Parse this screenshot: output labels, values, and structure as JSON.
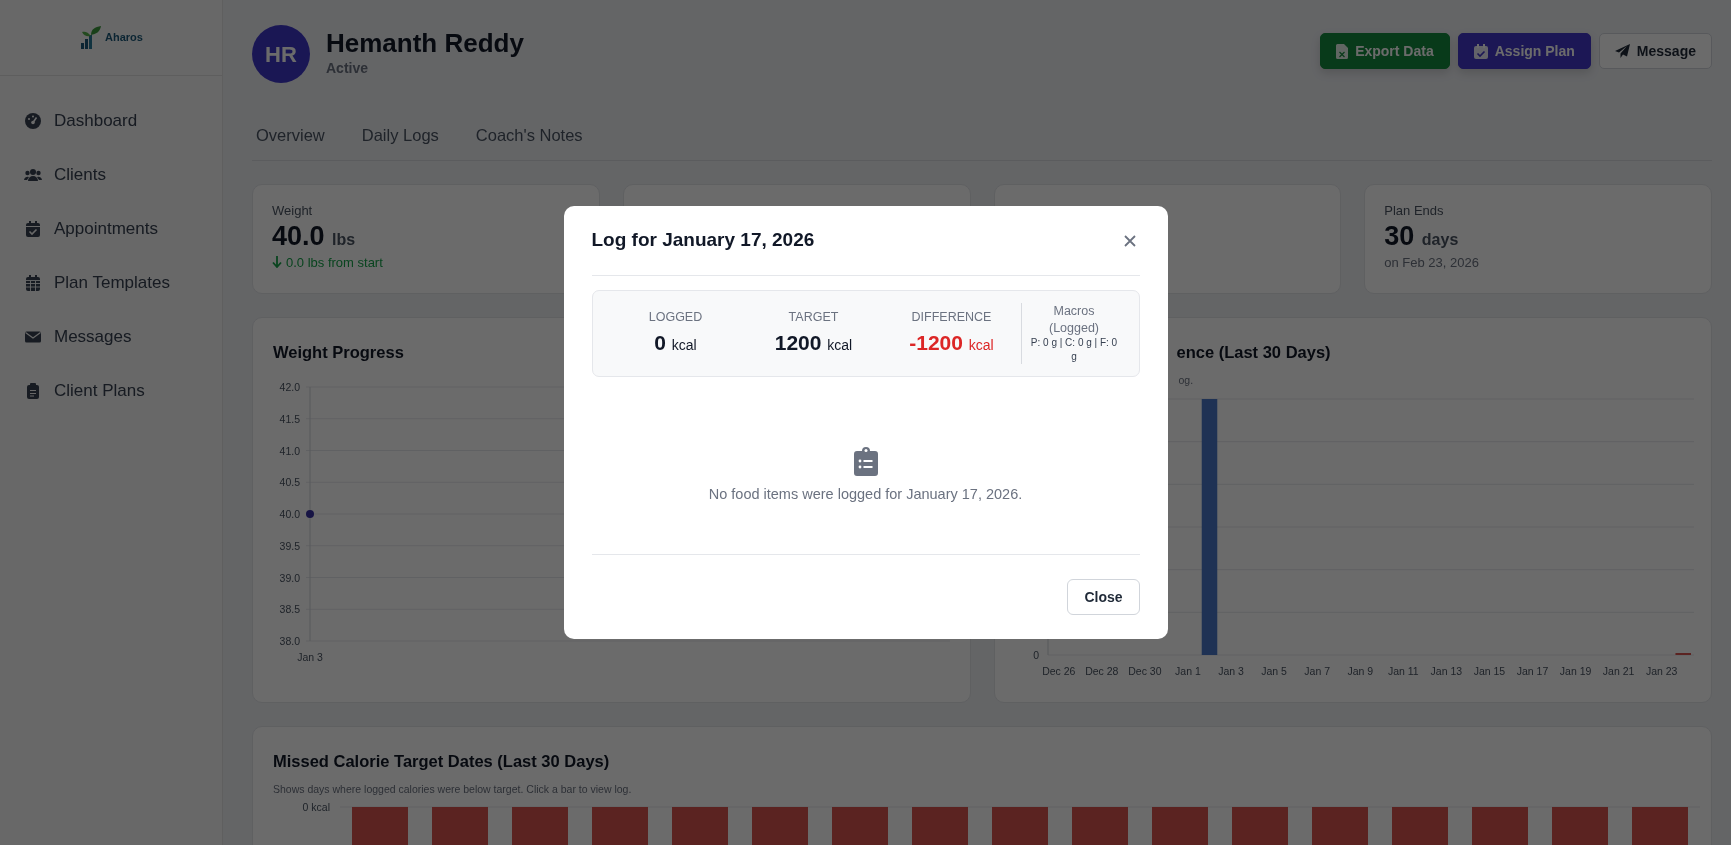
{
  "sidebar": {
    "logo": {
      "text": "Aharos"
    },
    "items": [
      {
        "label": "Dashboard",
        "selected": false
      },
      {
        "label": "Clients",
        "selected": false
      },
      {
        "label": "Appointments",
        "selected": false
      },
      {
        "label": "Plan Templates",
        "selected": false
      },
      {
        "label": "Messages",
        "selected": false
      },
      {
        "label": "Client Plans",
        "selected": false
      }
    ]
  },
  "client": {
    "initials": "HR",
    "name": "Hemanth Reddy",
    "status": "Active"
  },
  "actions": [
    {
      "label": "Export Data",
      "kind": "success"
    },
    {
      "label": "Assign Plan",
      "kind": "primary"
    },
    {
      "label": "Message",
      "kind": "outline"
    }
  ],
  "tabs": [
    {
      "label": "Overview",
      "selected": false
    },
    {
      "label": "Daily Logs",
      "selected": false
    },
    {
      "label": "Coach's Notes",
      "selected": false
    }
  ],
  "stat_cards": [
    {
      "kind": "metric",
      "label": "Weight",
      "value": "40.0",
      "unit": "lbs",
      "note": "0.0 lbs from start",
      "improved": true
    },
    {
      "kind": "covered"
    },
    {
      "kind": "covered"
    },
    {
      "kind": "metric",
      "label": "Plan Ends",
      "value": "30",
      "unit": "days",
      "note": "on Feb 23, 2026",
      "improved": false
    }
  ],
  "weight_chart": {
    "title": "Weight Progress",
    "chart_data": {
      "type": "line",
      "categories": [
        "Jan 3"
      ],
      "grid": true,
      "series": [
        {
          "color": "#3730a3",
          "marker": "circle",
          "values": [
            40.0
          ]
        }
      ],
      "ylim": [
        38,
        42
      ],
      "yticks": [
        {
          "value": 42,
          "label": "42.0"
        },
        {
          "value": 41.5,
          "label": "41.5"
        },
        {
          "value": 41,
          "label": "41.0"
        },
        {
          "value": 40.5,
          "label": "40.5"
        },
        {
          "value": 40,
          "label": "40.0"
        },
        {
          "value": 39.5,
          "label": "39.5"
        },
        {
          "value": 39,
          "label": "39.0"
        },
        {
          "value": 38.5,
          "label": "38.5"
        },
        {
          "value": 38,
          "label": "38.0"
        }
      ]
    }
  },
  "adherence_chart": {
    "title": "ence (Last 30 Days)",
    "subtitle": "og.",
    "y_label": "0",
    "x_labels": [
      "Dec 26",
      "Dec 28",
      "Dec 30",
      "Jan 1",
      "Jan 3",
      "Jan 5",
      "Jan 7",
      "Jan 9",
      "Jan 11",
      "Jan 13",
      "Jan 15",
      "Jan 17",
      "Jan 19",
      "Jan 21",
      "Jan 23"
    ]
  },
  "missed_chart": {
    "title": "Missed Calorie Target Dates (Last 30 Days)",
    "subtitle": "Shows days where logged calories were below target. Click a bar to view log.",
    "y_label": "0 kcal"
  },
  "modal": {
    "title": "Log for January 17, 2026",
    "summary": [
      {
        "label": "LOGGED",
        "value": "0",
        "unit": "kcal",
        "negative": false
      },
      {
        "label": "TARGET",
        "value": "1200",
        "unit": "kcal",
        "negative": false
      },
      {
        "label": "DIFFERENCE",
        "value": "-1200",
        "unit": "kcal",
        "negative": true
      }
    ],
    "macros": {
      "label": "Macros (Logged)",
      "text": "P: 0 g | C: 0 g | F: 0 g"
    },
    "empty_message": "No food items were logged for January 17, 2026.",
    "close_label": "Close"
  }
}
